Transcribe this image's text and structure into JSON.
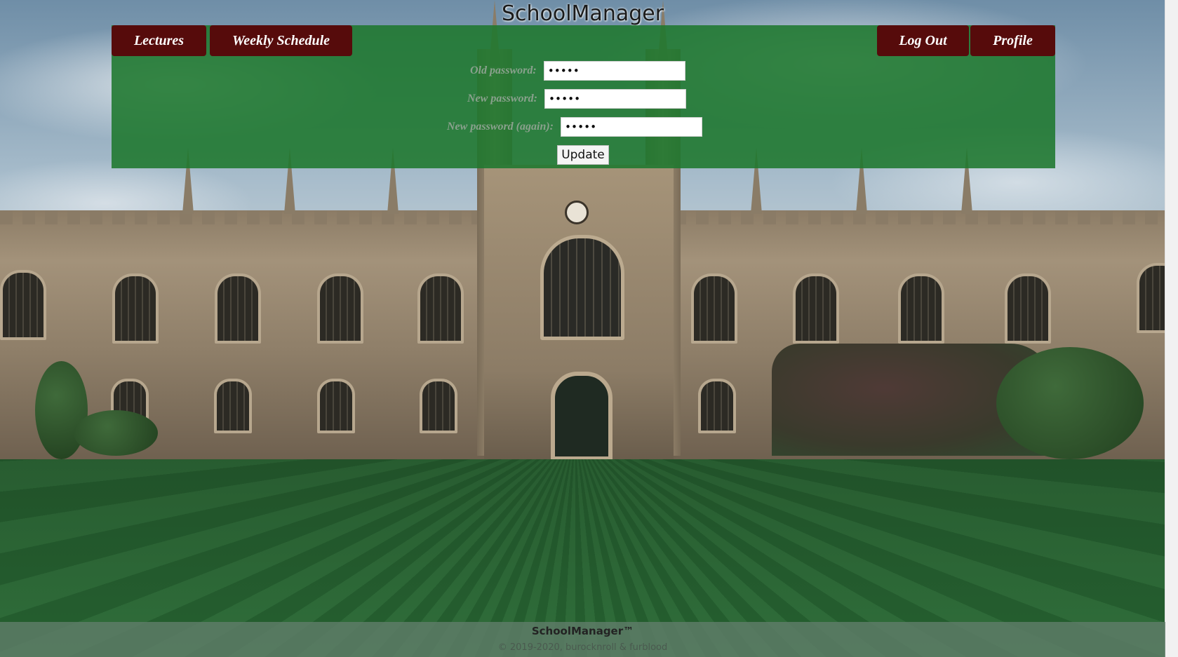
{
  "app": {
    "title": "SchoolManager"
  },
  "nav": {
    "lectures": "Lectures",
    "weekly_schedule": "Weekly Schedule",
    "log_out": "Log Out",
    "profile": "Profile"
  },
  "form": {
    "old_password": {
      "label": "Old password:",
      "value": "•••••"
    },
    "new_password": {
      "label": "New password:",
      "value": "•••••"
    },
    "new_password_again": {
      "label": "New password (again):",
      "value": "•••••"
    },
    "update_label": "Update"
  },
  "footer": {
    "brand": "SchoolManager™",
    "copyright": "© 2019-2020, burocknroll & furblood"
  },
  "colors": {
    "panel": "#1e782d",
    "nav_button": "#560b0b",
    "footer": "#5f7d69"
  }
}
